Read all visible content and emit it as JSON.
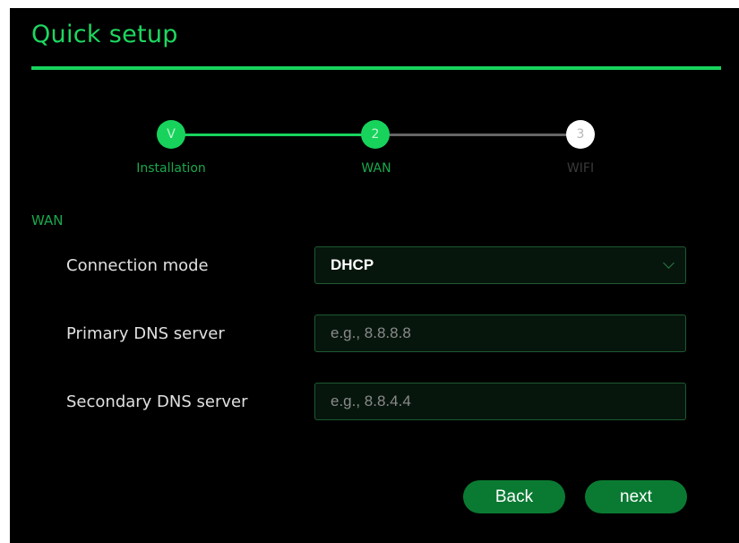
{
  "header": {
    "title": "Quick setup"
  },
  "stepper": {
    "steps": [
      {
        "marker": "V",
        "label": "Installation"
      },
      {
        "marker": "2",
        "label": "WAN"
      },
      {
        "marker": "3",
        "label": "WIFI"
      }
    ]
  },
  "section": {
    "label": "WAN"
  },
  "form": {
    "connection_mode": {
      "label": "Connection mode",
      "value": "DHCP"
    },
    "primary_dns": {
      "label": "Primary DNS server",
      "placeholder": "e.g., 8.8.8.8"
    },
    "secondary_dns": {
      "label": "Secondary DNS server",
      "placeholder": "e.g., 8.8.4.4"
    }
  },
  "buttons": {
    "back": "Back",
    "next": "next"
  },
  "colors": {
    "accent": "#17d35c",
    "button": "#0a7a32",
    "background": "#000000"
  }
}
